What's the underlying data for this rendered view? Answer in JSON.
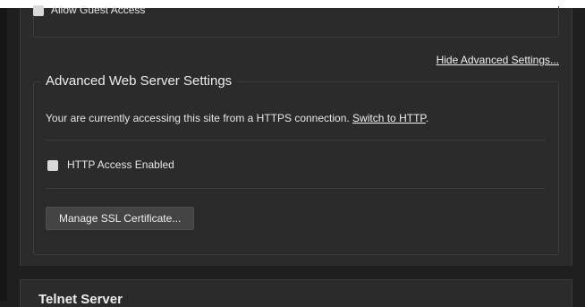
{
  "guest_access": {
    "label": "Allow Guest Access"
  },
  "advanced_toggle": {
    "label": "Hide Advanced Settings..."
  },
  "advanced_web_server": {
    "title": "Advanced Web Server Settings",
    "connection_message": "Your are currently accessing this site from a HTTPS connection.",
    "switch_link": "Switch to HTTP",
    "period": ".",
    "http_access_label": "HTTP Access Enabled",
    "http_access_checked": false,
    "ssl_button_label": "Manage SSL Certificate..."
  },
  "telnet_server": {
    "title": "Telnet Server"
  },
  "colors": {
    "panel_bg": "#2b2b2b",
    "page_bg": "#1f1f1f",
    "text": "#e6e6e6",
    "border": "#3c3c3c",
    "button_bg": "#444444"
  }
}
